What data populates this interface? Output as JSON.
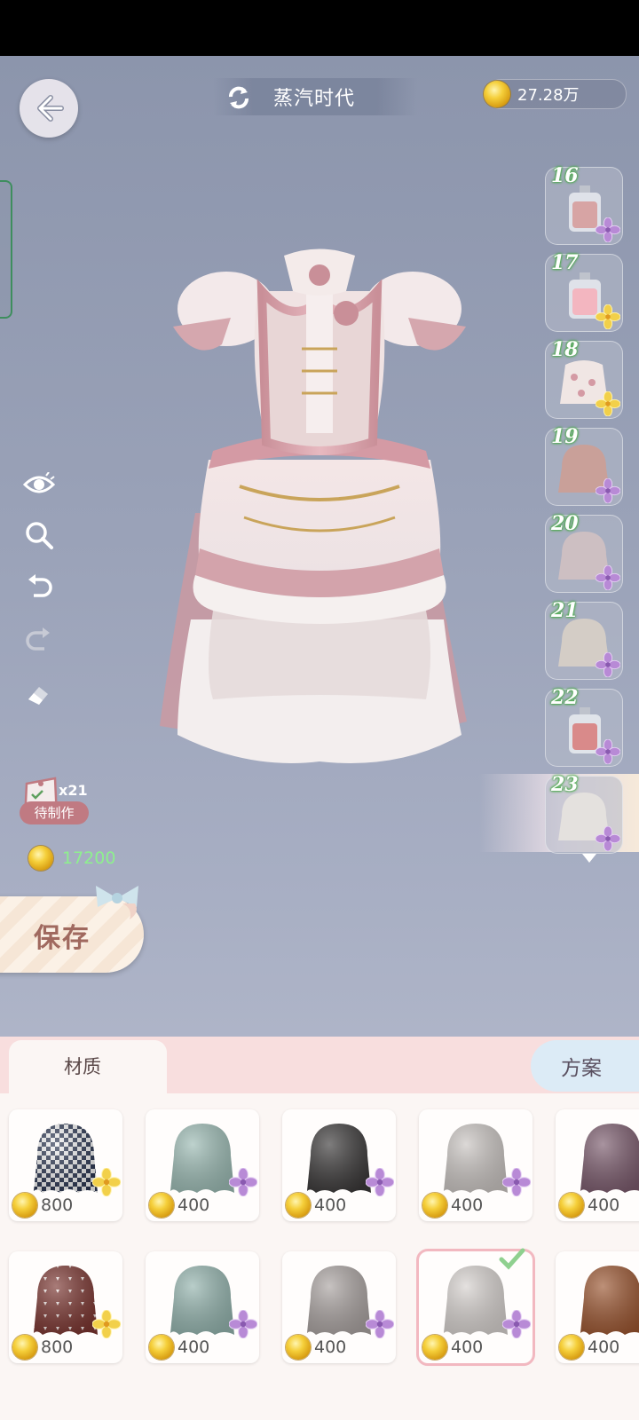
{
  "header": {
    "title": "蒸汽时代",
    "coins": "27.28万"
  },
  "tools": [
    "eye-icon",
    "zoom-icon",
    "undo-icon",
    "redo-icon",
    "eraser-icon"
  ],
  "slots": [
    {
      "num": "16",
      "kind": "bottle-rose"
    },
    {
      "num": "17",
      "kind": "bottle-pink"
    },
    {
      "num": "18",
      "kind": "floral"
    },
    {
      "num": "19",
      "kind": "cloth-rose"
    },
    {
      "num": "20",
      "kind": "cloth-lilac"
    },
    {
      "num": "21",
      "kind": "cloth-cream"
    },
    {
      "num": "22",
      "kind": "bottle-coral"
    },
    {
      "num": "23",
      "kind": "cloth-white"
    }
  ],
  "production": {
    "count": "x21",
    "label": "待制作",
    "cost": "17200"
  },
  "save_label": "保存",
  "tabs": {
    "material": "材质",
    "plan": "方案"
  },
  "materials": [
    {
      "price": "800",
      "color": "#2a3550",
      "pattern": "houndstooth",
      "flower": "yellow"
    },
    {
      "price": "400",
      "color": "#9bbab3",
      "flower": "purple"
    },
    {
      "price": "400",
      "color": "#3a3838",
      "flower": "purple"
    },
    {
      "price": "400",
      "color": "#c9c4c1",
      "flower": "purple"
    },
    {
      "price": "400",
      "color": "#7a5a6c",
      "flower": "purple"
    },
    {
      "price": "800",
      "color": "#7a3530",
      "pattern": "triangles",
      "flower": "yellow"
    },
    {
      "price": "400",
      "color": "#93b3ad",
      "flower": "purple"
    },
    {
      "price": "400",
      "color": "#a9a2a0",
      "flower": "purple"
    },
    {
      "price": "400",
      "color": "#d6d1ce",
      "flower": "purple",
      "selected": true
    },
    {
      "price": "400",
      "color": "#9a5530",
      "flower": "purple"
    }
  ]
}
